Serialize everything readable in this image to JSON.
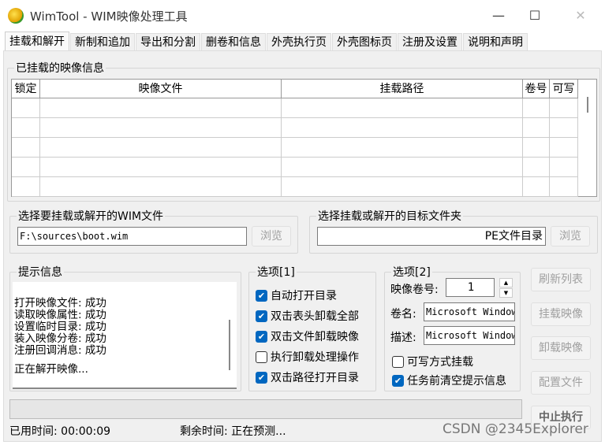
{
  "window": {
    "title": "WimTool - WIM映像处理工具",
    "minimize": "—",
    "maximize": "☐",
    "close": "✕"
  },
  "tabs": [
    "挂载和解开",
    "新制和追加",
    "导出和分割",
    "删卷和信息",
    "外壳执行页",
    "外壳图标页",
    "注册及设置",
    "说明和声明"
  ],
  "mounted": {
    "label": "已挂载的映像信息",
    "columns": [
      "锁定",
      "映像文件",
      "挂载路径",
      "卷号",
      "可写"
    ]
  },
  "wim_group": {
    "label": "选择要挂载或解开的WIM文件",
    "value": "F:\\sources\\boot.wim",
    "browse": "浏览"
  },
  "target_group": {
    "label": "选择挂载或解开的目标文件夹",
    "value": "PE文件目录",
    "browse": "浏览"
  },
  "info": {
    "label": "提示信息",
    "lines": [
      "打开映像文件: 成功",
      "读取映像属性: 成功",
      "设置临时目录: 成功",
      "装入映像分卷: 成功",
      "注册回调消息: 成功"
    ],
    "status": "正在解开映像..."
  },
  "options1": {
    "label": "选项[1]",
    "items": [
      {
        "label": "自动打开目录",
        "checked": true
      },
      {
        "label": "双击表头卸载全部",
        "checked": true
      },
      {
        "label": "双击文件卸载映像",
        "checked": true
      },
      {
        "label": "执行卸载处理操作",
        "checked": false
      },
      {
        "label": "双击路径打开目录",
        "checked": true
      }
    ]
  },
  "options2": {
    "label": "选项[2]",
    "volume_label": "映像卷号:",
    "volume": "1",
    "name_label": "卷名:",
    "name": "Microsoft Windows",
    "desc_label": "描述:",
    "desc": "Microsoft Windows",
    "items": [
      {
        "label": "可写方式挂载",
        "checked": false
      },
      {
        "label": "任务前清空提示信息",
        "checked": true
      }
    ]
  },
  "buttons": {
    "refresh": "刷新列表",
    "mount": "挂载映像",
    "unmount": "卸载映像",
    "config": "配置文件",
    "abort": "中止执行"
  },
  "progress": 0,
  "status": {
    "elapsed_label": "已用时间:",
    "elapsed": "00:00:09",
    "remaining_label": "剩余时间:",
    "remaining": "正在预测..."
  },
  "watermark": "CSDN @2345Explorer"
}
